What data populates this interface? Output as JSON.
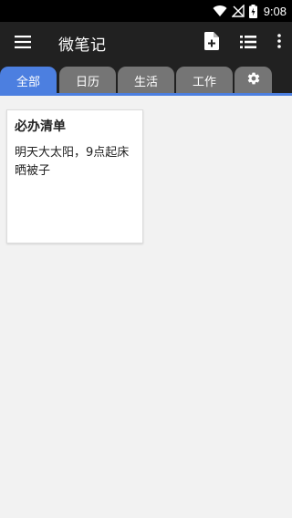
{
  "status_bar": {
    "time": "9:08",
    "icons": [
      "wifi-icon",
      "no-signal-icon",
      "battery-charging-icon"
    ]
  },
  "app_bar": {
    "title": "微笔记",
    "icons": [
      "menu-icon",
      "new-note-icon",
      "list-view-icon",
      "more-vert-icon"
    ]
  },
  "tabs": [
    {
      "label": "全部",
      "active": true
    },
    {
      "label": "日历",
      "active": false
    },
    {
      "label": "生活",
      "active": false
    },
    {
      "label": "工作",
      "active": false
    },
    {
      "label": "",
      "icon": "settings-gear-icon",
      "active": false
    }
  ],
  "notes": [
    {
      "title": "必办清单",
      "body": "明天大太阳，9点起床晒被子"
    }
  ],
  "colors": {
    "app_bar": "#212121",
    "accent": "#4c7fe0",
    "tab_inactive": "#757575",
    "background": "#f2f2f2"
  }
}
